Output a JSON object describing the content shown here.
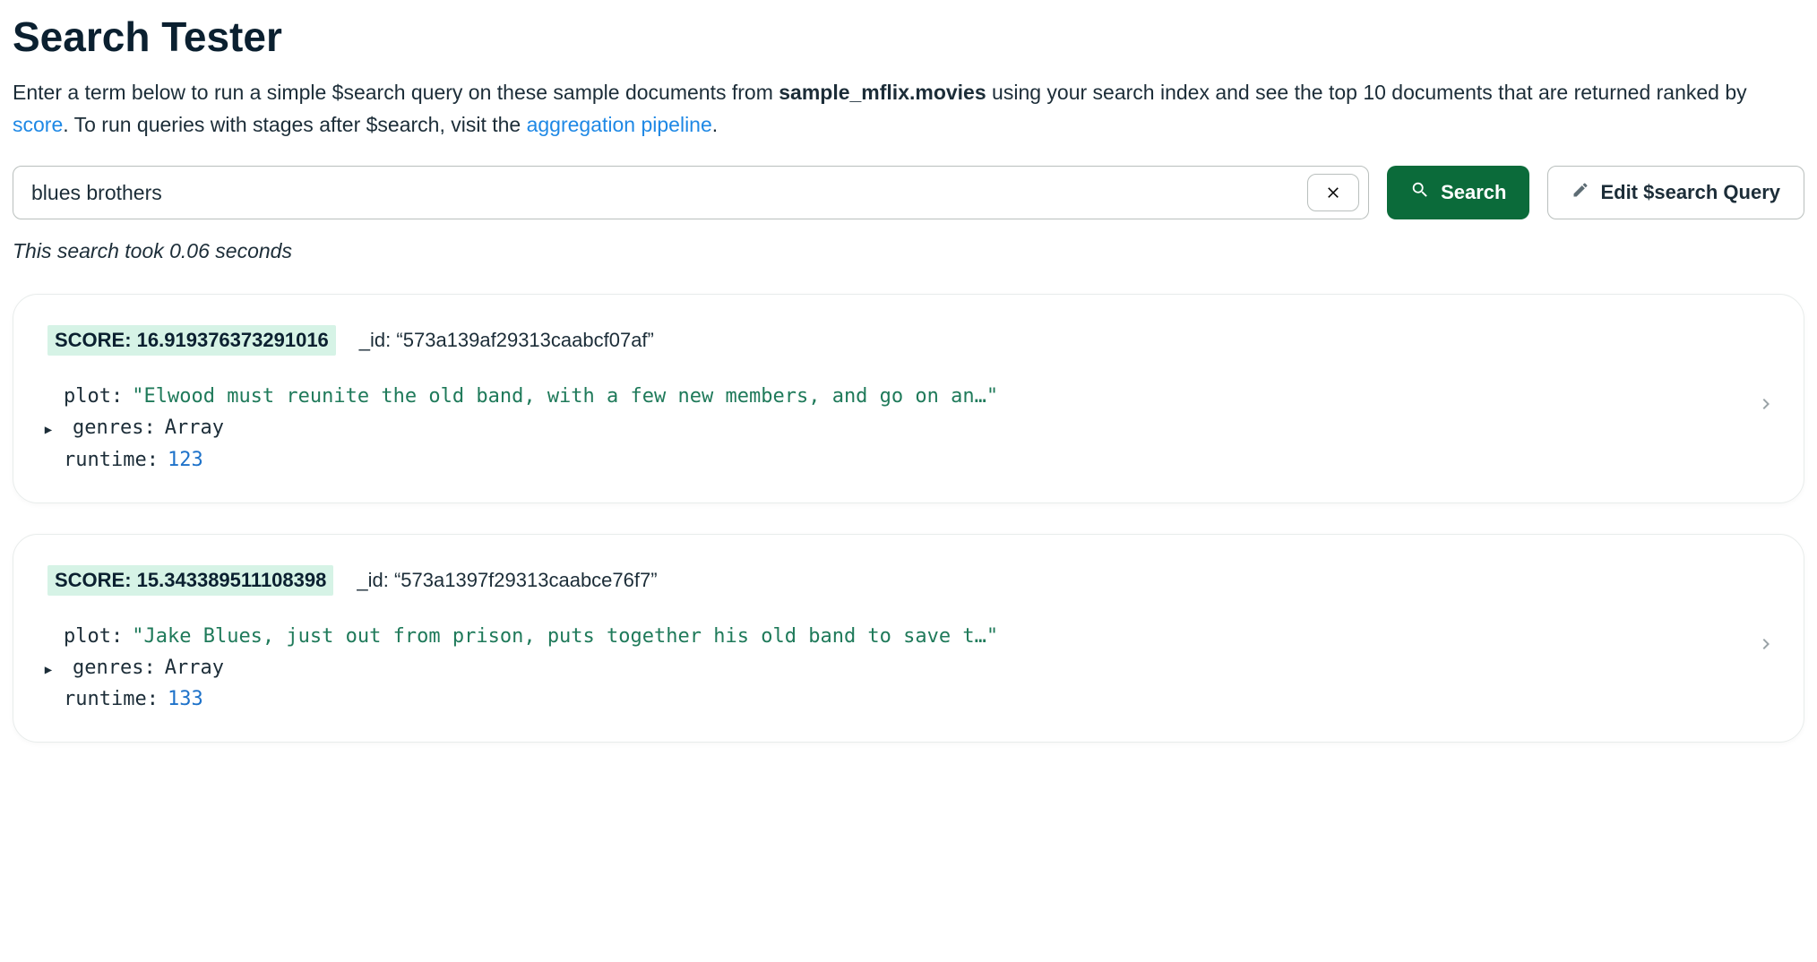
{
  "page": {
    "title": "Search Tester",
    "intro_pre": "Enter a term below to run a simple $search query on these sample documents from ",
    "intro_collection": "sample_mflix.movies",
    "intro_mid": " using your search index and see the top 10 documents that are returned ranked by ",
    "intro_score_link": "score",
    "intro_post_score": ". To run queries with stages after $search, visit the ",
    "intro_agg_link": "aggregation pipeline",
    "intro_end": "."
  },
  "search": {
    "value": "blues brothers",
    "search_button": "Search",
    "edit_button": "Edit $search Query"
  },
  "status": {
    "text": "This search took 0.06 seconds"
  },
  "results": [
    {
      "score_label": "SCORE: 16.919376373291016",
      "id_label": "_id:",
      "id_value": "“573a139af29313caabcf07af”",
      "plot_key": "plot:",
      "plot_value": "\"Elwood must reunite the old band, with a few new members, and go on an…\"",
      "genres_key": "genres:",
      "genres_value": "Array",
      "runtime_key": "runtime:",
      "runtime_value": "123"
    },
    {
      "score_label": "SCORE: 15.343389511108398",
      "id_label": "_id:",
      "id_value": "“573a1397f29313caabce76f7”",
      "plot_key": "plot:",
      "plot_value": "\"Jake Blues, just out from prison, puts together his old band to save t…\"",
      "genres_key": "genres:",
      "genres_value": "Array",
      "runtime_key": "runtime:",
      "runtime_value": "133"
    }
  ]
}
